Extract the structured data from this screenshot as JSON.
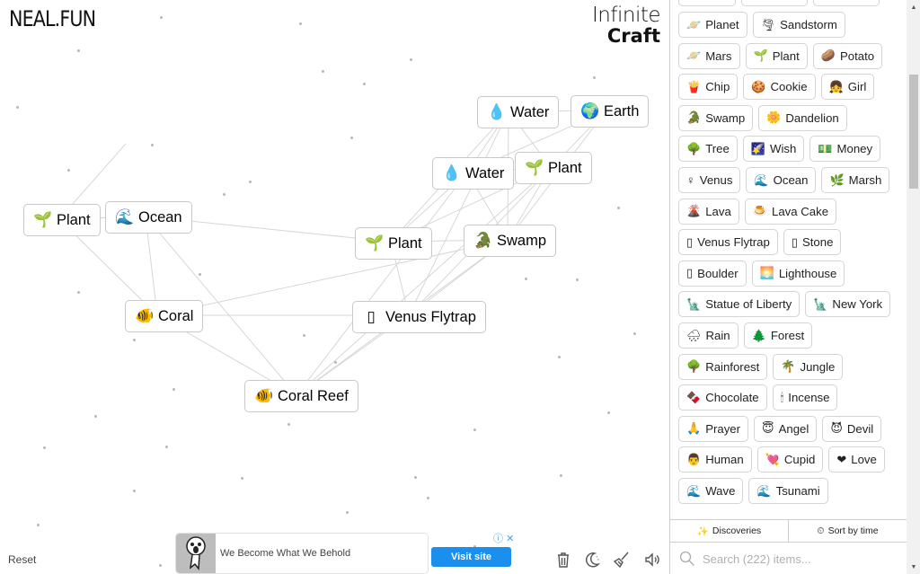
{
  "header": {
    "logo": "NEAL.FUN",
    "brand_line1": "Infinite",
    "brand_line2": "Craft"
  },
  "canvas": {
    "nodes": [
      {
        "id": "water-1",
        "label": "Water",
        "emoji": "💧"
      },
      {
        "id": "earth-1",
        "label": "Earth",
        "emoji": "🌍"
      },
      {
        "id": "water-2",
        "label": "Water",
        "emoji": "💧"
      },
      {
        "id": "plant-1",
        "label": "Plant",
        "emoji": "🌱"
      },
      {
        "id": "plant-2",
        "label": "Plant",
        "emoji": "🌱"
      },
      {
        "id": "ocean-1",
        "label": "Ocean",
        "emoji": "🌊"
      },
      {
        "id": "plant-3",
        "label": "Plant",
        "emoji": "🌱"
      },
      {
        "id": "swamp-1",
        "label": "Swamp",
        "emoji": "🐊"
      },
      {
        "id": "coral-1",
        "label": "Coral",
        "emoji": "🐠"
      },
      {
        "id": "venus-flytrap-1",
        "label": "Venus Flytrap",
        "emoji": "▯"
      },
      {
        "id": "coral-reef-1",
        "label": "Coral Reef",
        "emoji": "🐠"
      }
    ],
    "reset_label": "Reset"
  },
  "ad": {
    "title": "We Become What We Behold",
    "cta": "Visit site",
    "info_icon": "ⓘ",
    "close_icon": "✕"
  },
  "toolbar": {
    "tools": [
      {
        "name": "trash-icon",
        "title": "Clear"
      },
      {
        "name": "moon-icon",
        "title": "Dark mode"
      },
      {
        "name": "broom-icon",
        "title": "Clean up"
      },
      {
        "name": "sound-icon",
        "title": "Sound"
      }
    ]
  },
  "sidebar": {
    "rows": [
      [
        {
          "label": "Planet",
          "emoji": "🪐"
        },
        {
          "label": "Sandstorm",
          "emoji": "🌪"
        }
      ],
      [
        {
          "label": "Mars",
          "emoji": "🪐"
        },
        {
          "label": "Plant",
          "emoji": "🌱"
        },
        {
          "label": "Potato",
          "emoji": "🥔"
        }
      ],
      [
        {
          "label": "Chip",
          "emoji": "🍟"
        },
        {
          "label": "Cookie",
          "emoji": "🍪"
        },
        {
          "label": "Girl",
          "emoji": "👧"
        }
      ],
      [
        {
          "label": "Swamp",
          "emoji": "🐊"
        },
        {
          "label": "Dandelion",
          "emoji": "🌼"
        }
      ],
      [
        {
          "label": "Tree",
          "emoji": "🌳"
        },
        {
          "label": "Wish",
          "emoji": "🌠"
        },
        {
          "label": "Money",
          "emoji": "💵"
        }
      ],
      [
        {
          "label": "Venus",
          "emoji": "♀"
        },
        {
          "label": "Ocean",
          "emoji": "🌊"
        },
        {
          "label": "Marsh",
          "emoji": "🌿"
        }
      ],
      [
        {
          "label": "Lava",
          "emoji": "🌋"
        },
        {
          "label": "Lava Cake",
          "emoji": "🍮"
        }
      ],
      [
        {
          "label": "Venus Flytrap",
          "emoji": "▯"
        },
        {
          "label": "Stone",
          "emoji": "▯"
        }
      ],
      [
        {
          "label": "Boulder",
          "emoji": "▯"
        },
        {
          "label": "Lighthouse",
          "emoji": "🌅"
        }
      ],
      [
        {
          "label": "Statue of Liberty",
          "emoji": "🗽"
        },
        {
          "label": "New York",
          "emoji": "🗽"
        }
      ],
      [
        {
          "label": "Rain",
          "emoji": "🌧"
        },
        {
          "label": "Forest",
          "emoji": "🌲"
        }
      ],
      [
        {
          "label": "Rainforest",
          "emoji": "🌳"
        },
        {
          "label": "Jungle",
          "emoji": "🌴"
        }
      ],
      [
        {
          "label": "Chocolate",
          "emoji": "🍫"
        },
        {
          "label": "Incense",
          "emoji": "🕯"
        }
      ],
      [
        {
          "label": "Prayer",
          "emoji": "🙏"
        },
        {
          "label": "Angel",
          "emoji": "😇"
        },
        {
          "label": "Devil",
          "emoji": "😈"
        }
      ],
      [
        {
          "label": "Human",
          "emoji": "👨"
        },
        {
          "label": "Cupid",
          "emoji": "💘"
        },
        {
          "label": "Love",
          "emoji": "❤"
        }
      ],
      [
        {
          "label": "Wave",
          "emoji": "🌊"
        },
        {
          "label": "Tsunami",
          "emoji": "🌊"
        }
      ]
    ],
    "tabs": [
      {
        "label": "Discoveries",
        "icon": "sparkles-icon",
        "glyph": "✨"
      },
      {
        "label": "Sort by time",
        "icon": "clock-icon",
        "glyph": "⏲"
      }
    ],
    "search": {
      "placeholder": "Search (222) items...",
      "value": ""
    },
    "scroll": {
      "position_fraction": 0.12,
      "visible_fraction": 0.21
    }
  }
}
